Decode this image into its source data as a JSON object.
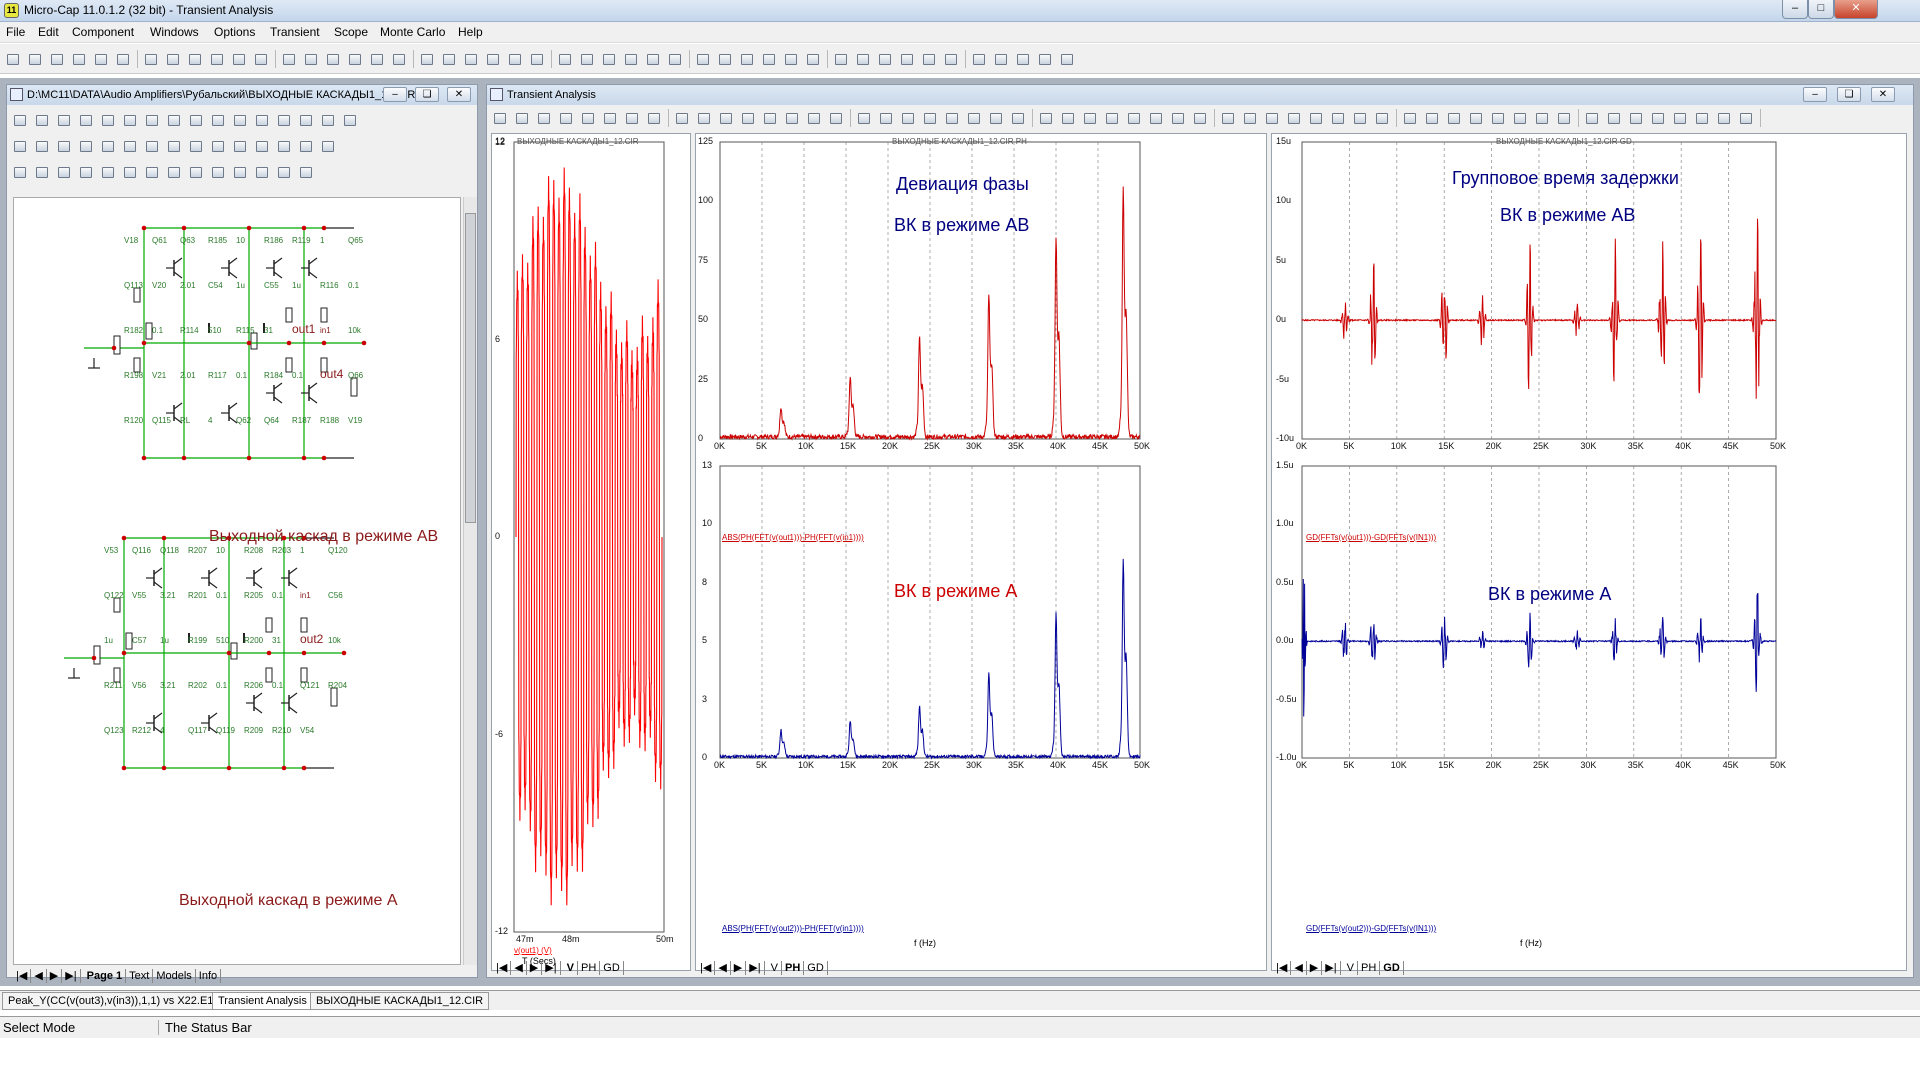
{
  "app": {
    "title": "Micro-Cap 11.0.1.2 (32 bit) - Transient Analysis",
    "icon": "mc-icon"
  },
  "menu": [
    "File",
    "Edit",
    "Component",
    "Windows",
    "Options",
    "Transient",
    "Scope",
    "Monte Carlo",
    "Help"
  ],
  "schematic": {
    "title": "D:\\MC11\\DATA\\Audio Amplifiers\\Рубальский\\ВЫХОДНЫЕ КАСКАДЫ1_12.CIR",
    "caption_ab": "Выходной каскад в режиме АВ",
    "caption_a": "Выходной каскад в режиме А",
    "tabs": [
      "Page 1",
      "Text",
      "Models",
      "Info"
    ],
    "labels_ab": [
      {
        "t": "V18"
      },
      {
        "t": "Q61"
      },
      {
        "t": "Q63"
      },
      {
        "t": "R185"
      },
      {
        "t": "10"
      },
      {
        "t": "R186"
      },
      {
        "t": "R119"
      },
      {
        "t": "1"
      },
      {
        "t": "Q65"
      },
      {
        "t": "Q113"
      },
      {
        "t": "V20"
      },
      {
        "t": "2.01"
      },
      {
        "t": "C54"
      },
      {
        "t": "1u"
      },
      {
        "t": "C55"
      },
      {
        "t": "1u"
      },
      {
        "t": "R116"
      },
      {
        "t": "0.1"
      },
      {
        "t": "R182"
      },
      {
        "t": "0.1"
      },
      {
        "t": "R114"
      },
      {
        "t": "510"
      },
      {
        "t": "R115"
      },
      {
        "t": "31"
      },
      {
        "t": "out1"
      },
      {
        "t": "in1"
      },
      {
        "t": "10k"
      },
      {
        "t": "R198"
      },
      {
        "t": "V21"
      },
      {
        "t": "2.01"
      },
      {
        "t": "R117"
      },
      {
        "t": "0.1"
      },
      {
        "t": "R184"
      },
      {
        "t": "0.1"
      },
      {
        "t": "out4"
      },
      {
        "t": "Q66"
      },
      {
        "t": "R120"
      },
      {
        "t": "Q115"
      },
      {
        "t": "RL"
      },
      {
        "t": "4"
      },
      {
        "t": "Q62"
      },
      {
        "t": "Q64"
      },
      {
        "t": "R187"
      },
      {
        "t": "R188"
      },
      {
        "t": "V19"
      }
    ],
    "labels_a": [
      {
        "t": "V53"
      },
      {
        "t": "Q116"
      },
      {
        "t": "Q118"
      },
      {
        "t": "R207"
      },
      {
        "t": "10"
      },
      {
        "t": "R208"
      },
      {
        "t": "R203"
      },
      {
        "t": "1"
      },
      {
        "t": "Q120"
      },
      {
        "t": "Q122"
      },
      {
        "t": "V55"
      },
      {
        "t": "3.21"
      },
      {
        "t": "R201"
      },
      {
        "t": "0.1"
      },
      {
        "t": "R205"
      },
      {
        "t": "0.1"
      },
      {
        "t": "in1"
      },
      {
        "t": "C56"
      },
      {
        "t": "1u"
      },
      {
        "t": "C57"
      },
      {
        "t": "1u"
      },
      {
        "t": "R199"
      },
      {
        "t": "510"
      },
      {
        "t": "R200"
      },
      {
        "t": "31"
      },
      {
        "t": "out2"
      },
      {
        "t": "10k"
      },
      {
        "t": "R211"
      },
      {
        "t": "V56"
      },
      {
        "t": "3.21"
      },
      {
        "t": "R202"
      },
      {
        "t": "0.1"
      },
      {
        "t": "R206"
      },
      {
        "t": "0.1"
      },
      {
        "t": "Q121"
      },
      {
        "t": "R204"
      },
      {
        "t": "Q123"
      },
      {
        "t": "R212"
      },
      {
        "t": "4"
      },
      {
        "t": "Q117"
      },
      {
        "t": "Q119"
      },
      {
        "t": "R209"
      },
      {
        "t": "R210"
      },
      {
        "t": "V54"
      }
    ]
  },
  "analysis": {
    "title": "Transient Analysis",
    "left_plot": {
      "title": "ВЫХОДНЫЕ КАСКАДЫ1_12.CIR",
      "y_ticks": [
        "12",
        "6",
        "0",
        "-6",
        "-12"
      ],
      "top_tick": "12",
      "x_ticks": [
        "47m",
        "48m",
        "50m"
      ],
      "trace_label": "v(out1) (V)",
      "x_label": "T (Secs)",
      "color": "#ff0000",
      "tabs": [
        "V",
        "PH",
        "GD"
      ]
    },
    "mid_plot": {
      "title": "ВЫХОДНЫЕ КАСКАДЫ1_12.CIR PH",
      "upper": {
        "y_ticks": [
          "125",
          "100",
          "75",
          "50",
          "25",
          "0"
        ],
        "formula": "ABS(PH(FFT(v(out1)))-PH(FFT(v(in1))))",
        "anno1": "Девиация фазы",
        "anno2": "ВК в режиме АВ",
        "color": "#cc0000"
      },
      "lower": {
        "y_ticks": [
          "13",
          "10",
          "8",
          "5",
          "3",
          "0"
        ],
        "formula": "ABS(PH(FFT(v(out2)))-PH(FFT(v(in1))))",
        "anno": "ВК в режиме А",
        "color": "#000099"
      },
      "x_ticks": [
        "0K",
        "5K",
        "10K",
        "15K",
        "20K",
        "25K",
        "30K",
        "35K",
        "40K",
        "45K",
        "50K"
      ],
      "x_label": "f (Hz)",
      "tabs": [
        "V",
        "PH",
        "GD"
      ]
    },
    "right_plot": {
      "title": "ВЫХОДНЫЕ КАСКАДЫ1_12.CIR GD",
      "upper": {
        "y_ticks": [
          "15u",
          "10u",
          "5u",
          "0u",
          "-5u",
          "-10u"
        ],
        "formula": "GD(FFTs(v(out1)))-GD(FFTs(v(IN1)))",
        "anno1": "Групповое время задержки",
        "anno2": "ВК в режиме АВ",
        "color": "#cc0000"
      },
      "lower": {
        "y_ticks": [
          "1.5u",
          "1.0u",
          "0.5u",
          "0.0u",
          "-0.5u",
          "-1.0u"
        ],
        "formula": "GD(FFTs(v(out2)))-GD(FFTs(v(IN1)))",
        "anno": "ВК в режиме А",
        "color": "#000099"
      },
      "x_ticks": [
        "0K",
        "5K",
        "10K",
        "15K",
        "20K",
        "25K",
        "30K",
        "35K",
        "40K",
        "45K",
        "50K"
      ],
      "x_label": "f (Hz)",
      "tabs": [
        "V",
        "PH",
        "GD"
      ]
    }
  },
  "bottom_tabs": [
    "Peak_Y(CC(v(out3),v(in3)),1,1) vs X22.E1",
    "Transient Analysis",
    "ВЫХОДНЫЕ КАСКАДЫ1_12.CIR"
  ],
  "status": {
    "mode": "Select Mode",
    "text": "The Status Bar"
  },
  "chart_data": [
    {
      "type": "line",
      "title": "ВЫХОДНЫЕ КАСКАДЫ1_12.CIR",
      "xlabel": "T (Secs)",
      "ylabel": "v(out1) (V)",
      "xlim": [
        0.047,
        0.05
      ],
      "ylim": [
        -12,
        12
      ],
      "series": [
        {
          "name": "v(out1) (V)",
          "description_values": {
            "envelope_max": [
              9,
              8.3,
              11.2,
              8.3
            ],
            "envelope_min": [
              -9,
              -8.3,
              -11.2,
              -8.3
            ],
            "cycles": 28
          }
        }
      ]
    },
    {
      "type": "line",
      "title": "ВЫХОДНЫЕ КАСКАДЫ1_12.CIR PH",
      "xlabel": "f (Hz)",
      "ylabel": "ABS(PH(FFT(v(out1)))-PH(FFT(v(in1))))",
      "xlim": [
        0,
        50000
      ],
      "ylim": [
        0,
        125
      ],
      "x": [
        8000,
        16000,
        24000,
        32000,
        40000,
        48000
      ],
      "series": [
        {
          "name": "ABS(PH(FFT(v(out1)))-PH(FFT(v(in1))))",
          "values": [
            12,
            25,
            42,
            58,
            82,
            100
          ]
        }
      ]
    },
    {
      "type": "line",
      "title": "ВЫХОДНЫЕ КАСКАДЫ1_12.CIR PH",
      "xlabel": "f (Hz)",
      "ylabel": "ABS(PH(FFT(v(out2)))-PH(FFT(v(in1))))",
      "xlim": [
        0,
        50000
      ],
      "ylim": [
        0,
        13
      ],
      "x": [
        8000,
        16000,
        24000,
        32000,
        40000,
        48000
      ],
      "series": [
        {
          "name": "ABS(PH(FFT(v(out2)))-PH(FFT(v(in1))))",
          "values": [
            1.2,
            1.7,
            2.3,
            3.9,
            6.4,
            8.7
          ]
        }
      ]
    },
    {
      "type": "line",
      "title": "ВЫХОДНЫЕ КАСКАДЫ1_12.CIR GD",
      "xlabel": "f (Hz)",
      "ylabel": "GD(FFTs(v(out1)))-GD(FFTs(v(IN1)))",
      "xlim": [
        0,
        50000
      ],
      "ylim": [
        -1e-05,
        1.5e-05
      ],
      "x": [
        4500,
        7500,
        15000,
        19000,
        24000,
        29000,
        33000,
        38000,
        42000,
        48000
      ],
      "series": [
        {
          "name": "GD(FFTs(v(out1)))-GD(FFTs(v(IN1)))",
          "peak_abs": [
            1.5e-06,
            6e-06,
            6e-06,
            2.5e-06,
            7e-06,
            1.5e-06,
            9e-06,
            1e-05,
            8e-06,
            1.1e-05
          ]
        }
      ]
    },
    {
      "type": "line",
      "title": "ВЫХОДНЫЕ КАСКАДЫ1_12.CIR GD",
      "xlabel": "f (Hz)",
      "ylabel": "GD(FFTs(v(out2)))-GD(FFTs(v(IN1)))",
      "xlim": [
        0,
        50000
      ],
      "ylim": [
        -1e-06,
        1.5e-06
      ],
      "x": [
        0,
        4500,
        7500,
        15000,
        19000,
        24000,
        29000,
        33000,
        38000,
        42000,
        48000
      ],
      "series": [
        {
          "name": "GD(FFTs(v(out2)))-GD(FFTs(v(IN1)))",
          "peak_abs": [
            1e-06,
            2e-07,
            2.5e-07,
            2.5e-07,
            1e-07,
            2.5e-07,
            1e-07,
            2e-07,
            2.2e-07,
            2.2e-07,
            5e-07
          ]
        }
      ]
    }
  ]
}
